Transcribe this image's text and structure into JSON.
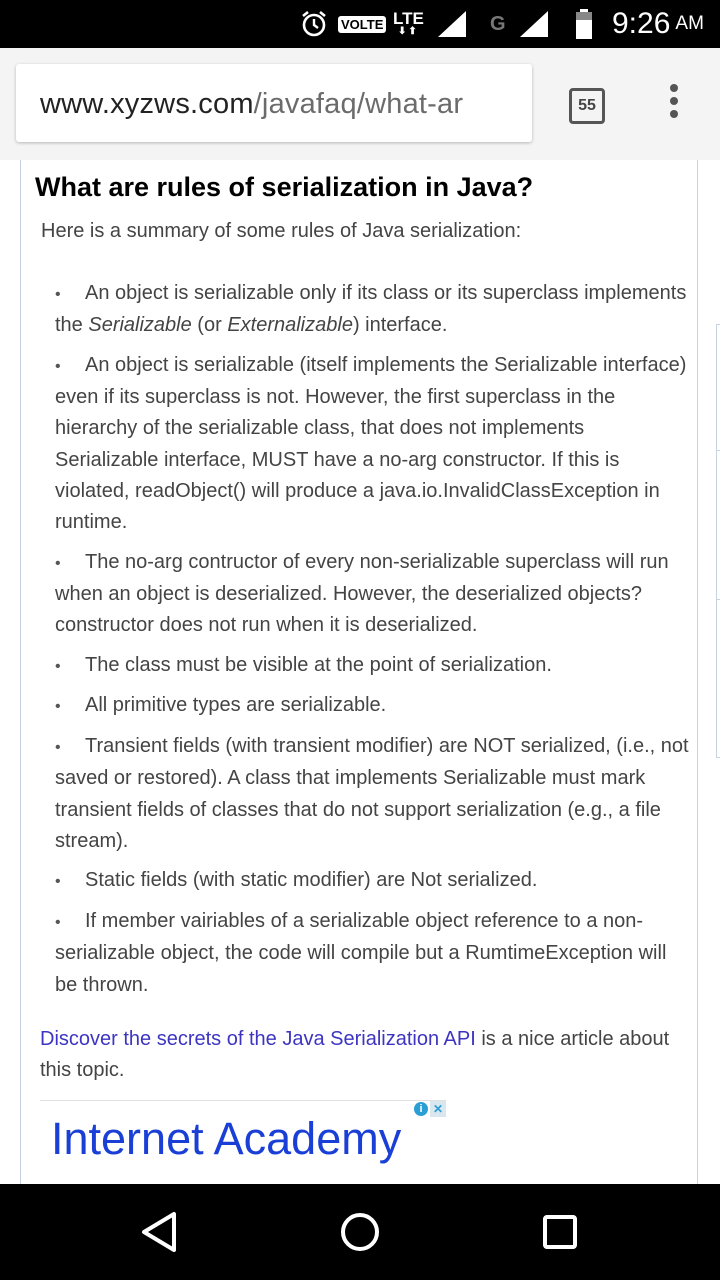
{
  "status_bar": {
    "volte": "VOLTE",
    "lte": "LTE",
    "lte_arrows": "⬇⬆",
    "g": "G",
    "time": "9:26",
    "ampm": "AM",
    "icons": [
      "alarm-icon",
      "signal-icon",
      "battery-icon"
    ]
  },
  "browser": {
    "url_domain": "www.xyzws.com",
    "url_path": "/javafaq/what-ar",
    "tab_count": "55",
    "menu_icon": "more-vert-icon"
  },
  "article": {
    "heading": "What are rules of serialization in Java?",
    "intro": "Here is a summary of some rules of Java serialization:",
    "bullet_symbol": "•",
    "rule1": {
      "a": "An object is serializable only if its class or its superclass implements the ",
      "b": "Serializable",
      "c": " (or  ",
      "d": "Externalizable",
      "e": ") interface."
    },
    "rules": [
      "An object is serializable (itself implements the Serializable interface) even if its superclass is not. However, the first superclass in the hierarchy of the serializable class, that does not implements Serializable interface, MUST have a no-arg constructor. If this is violated, readObject() will produce a java.io.InvalidClassException in runtime.",
      "The no-arg contructor of every non-serializable superclass will run when an object is deserialized. However, the deserialized objects? constructor does not run when it is deserialized.",
      "The class must be visible at the point of serialization.",
      "All primitive types are serializable.",
      "Transient fields (with transient modifier) are NOT serialized, (i.e., not saved or restored). A class that implements Serializable must mark transient fields of classes that do not support serialization (e.g., a file stream).",
      "Static fields (with static modifier) are Not serialized.",
      "If member vairiables of a serializable object reference to a non-serializable object, the code will compile but a RumtimeException will be thrown."
    ],
    "outro_link": "Discover the secrets of the Java Serialization API",
    "outro_text": " is a nice article about this topic."
  },
  "ad": {
    "title": "Internet Academy",
    "info": "i",
    "close": "✕"
  },
  "nav": {
    "icons": [
      "back-icon",
      "home-icon",
      "recents-icon"
    ]
  },
  "colors": {
    "link": "#3d35c1",
    "ad_title": "#1a3fd6",
    "frame_border": "#c7d3e2"
  }
}
